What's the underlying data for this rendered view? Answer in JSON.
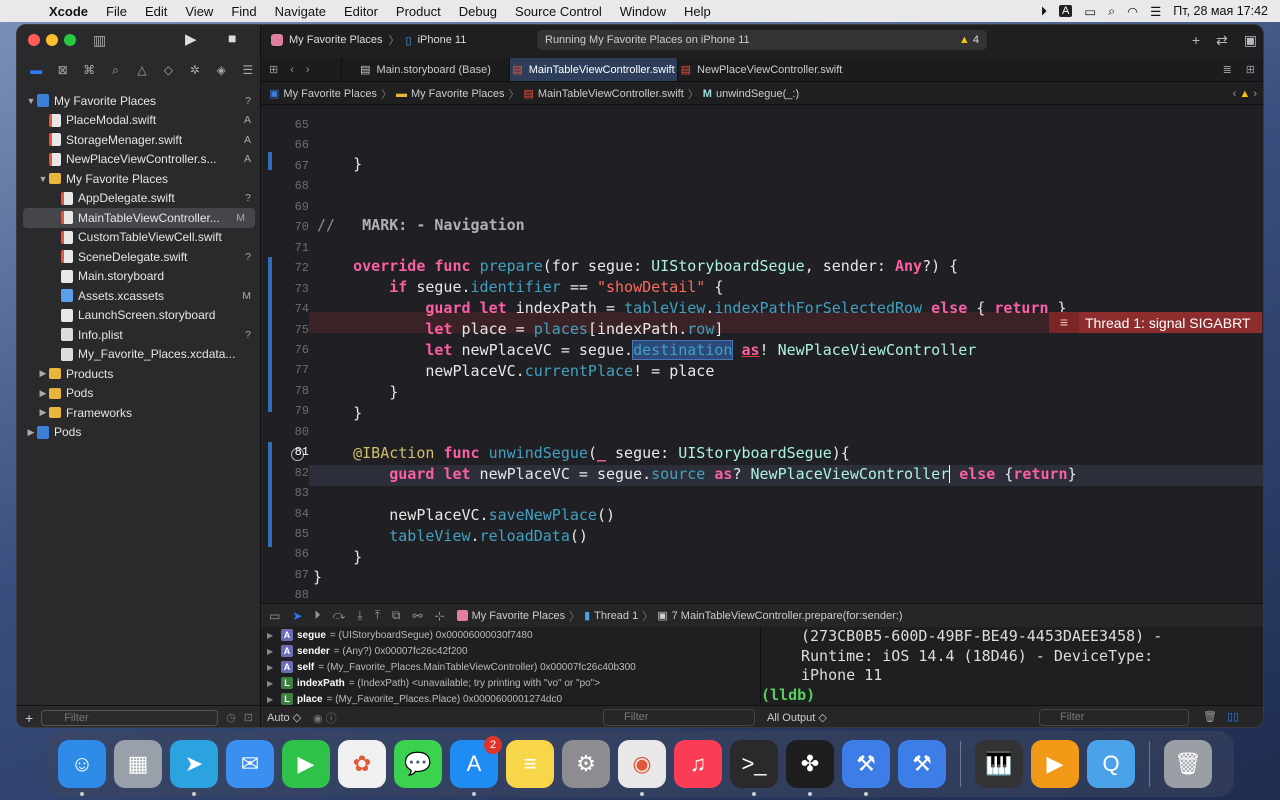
{
  "menubar": {
    "app": "Xcode",
    "items": [
      "File",
      "Edit",
      "View",
      "Find",
      "Navigate",
      "Editor",
      "Product",
      "Debug",
      "Source Control",
      "Window",
      "Help"
    ],
    "datetime": "Пт, 28 мая  17:42",
    "input_source": "A"
  },
  "toolbar": {
    "scheme": "My Favorite Places",
    "device": "iPhone 11",
    "status": "Running My Favorite Places on iPhone 11",
    "warnings": "4"
  },
  "navigator": {
    "items": [
      {
        "label": "My Favorite Places",
        "badge": "?",
        "icon": "project",
        "level": 0,
        "disclosure": "open"
      },
      {
        "label": "PlaceModal.swift",
        "badge": "A",
        "icon": "swift",
        "level": 1
      },
      {
        "label": "StorageMenager.swift",
        "badge": "A",
        "icon": "swift",
        "level": 1
      },
      {
        "label": "NewPlaceViewController.s...",
        "badge": "A",
        "icon": "swift",
        "level": 1
      },
      {
        "label": "My Favorite Places",
        "badge": "",
        "icon": "folder",
        "level": 1,
        "disclosure": "open"
      },
      {
        "label": "AppDelegate.swift",
        "badge": "?",
        "icon": "swift",
        "level": 2
      },
      {
        "label": "MainTableViewController...",
        "badge": "M",
        "icon": "swift",
        "level": 2,
        "selected": true
      },
      {
        "label": "CustomTableViewCell.swift",
        "badge": "",
        "icon": "swift",
        "level": 2
      },
      {
        "label": "SceneDelegate.swift",
        "badge": "?",
        "icon": "swift",
        "level": 2
      },
      {
        "label": "Main.storyboard",
        "badge": "",
        "icon": "storyboard",
        "level": 2
      },
      {
        "label": "Assets.xcassets",
        "badge": "M",
        "icon": "assets",
        "level": 2
      },
      {
        "label": "LaunchScreen.storyboard",
        "badge": "",
        "icon": "storyboard",
        "level": 2
      },
      {
        "label": "Info.plist",
        "badge": "?",
        "icon": "plist",
        "level": 2
      },
      {
        "label": "My_Favorite_Places.xcdata...",
        "badge": "",
        "icon": "plist",
        "level": 2
      },
      {
        "label": "Products",
        "badge": "",
        "icon": "folder",
        "level": 1,
        "disclosure": "closed"
      },
      {
        "label": "Pods",
        "badge": "",
        "icon": "folder",
        "level": 1,
        "disclosure": "closed"
      },
      {
        "label": "Frameworks",
        "badge": "",
        "icon": "folder",
        "level": 1,
        "disclosure": "closed"
      },
      {
        "label": "Pods",
        "badge": "",
        "icon": "project",
        "level": 0,
        "disclosure": "closed"
      }
    ],
    "filter_placeholder": "Filter"
  },
  "tabs": [
    {
      "label": "Main.storyboard (Base)",
      "active": false
    },
    {
      "label": "MainTableViewController.swift",
      "active": true
    },
    {
      "label": "NewPlaceViewController.swift",
      "active": false
    }
  ],
  "jumpbar": [
    "My Favorite Places",
    "My Favorite Places",
    "MainTableViewController.swift",
    "unwindSegue(_:)"
  ],
  "editor": {
    "line_numbers": [
      "65",
      "66",
      "67",
      "68",
      "69",
      "70",
      "71",
      "72",
      "73",
      "74",
      "75",
      "76",
      "77",
      "78",
      "79",
      "80",
      "81",
      "82",
      "83",
      "84",
      "85",
      "86",
      "87",
      "88"
    ],
    "error_line": "75",
    "current_line": "81",
    "error_message": "Thread 1: signal SIGABRT"
  },
  "debugbar": {
    "path": [
      "My Favorite Places",
      "Thread 1",
      "7 MainTableViewController.prepare(for:sender:)"
    ]
  },
  "variables": [
    {
      "badge": "A",
      "name": "segue",
      "value": "= (UIStoryboardSegue) 0x00006000030f7480"
    },
    {
      "badge": "A",
      "name": "sender",
      "value": "= (Any?) 0x00007fc26c42f200"
    },
    {
      "badge": "A",
      "name": "self",
      "value": "= (My_Favorite_Places.MainTableViewController) 0x00007fc26c40b300"
    },
    {
      "badge": "L",
      "name": "indexPath",
      "value": "= (IndexPath) <unavailable; try printing with \"vo\" or \"po\">"
    },
    {
      "badge": "L",
      "name": "place",
      "value": "= (My_Favorite_Places.Place) 0x0000600001274dc0"
    }
  ],
  "console": {
    "lines": [
      "(273CB0B5-600D-49BF-BE49-4453DAEE3458) -",
      "Runtime: iOS 14.4 (18D46) - DeviceType:",
      "iPhone 11"
    ],
    "prompt": "(lldb)"
  },
  "bottombar": {
    "auto": "Auto ◇",
    "filter_placeholder": "Filter",
    "all_output": "All Output ◇"
  },
  "dock": {
    "apps": [
      {
        "name": "finder-icon",
        "color": "#2f8be8",
        "glyph": "☺",
        "running": true
      },
      {
        "name": "launchpad-icon",
        "color": "#9aa0aa",
        "glyph": "▦",
        "running": false
      },
      {
        "name": "telegram-icon",
        "color": "#2aa3e0",
        "glyph": "➤",
        "running": true
      },
      {
        "name": "mail-icon",
        "color": "#3b8ff0",
        "glyph": "✉",
        "running": false
      },
      {
        "name": "facetime-icon",
        "color": "#2fc24a",
        "glyph": "▶",
        "running": false
      },
      {
        "name": "photos-icon",
        "color": "#f0f0f0",
        "glyph": "✿",
        "running": false
      },
      {
        "name": "messages-icon",
        "color": "#3ad24e",
        "glyph": "💬",
        "running": false
      },
      {
        "name": "appstore-icon",
        "color": "#1f8cf3",
        "glyph": "A",
        "running": true,
        "badge": "2"
      },
      {
        "name": "notes-icon",
        "color": "#f7d64a",
        "glyph": "≡",
        "running": false
      },
      {
        "name": "settings-icon",
        "color": "#8c8c91",
        "glyph": "⚙",
        "running": false
      },
      {
        "name": "chrome-icon",
        "color": "#e8e8e8",
        "glyph": "◉",
        "running": true
      },
      {
        "name": "music-icon",
        "color": "#fa3c55",
        "glyph": "♫",
        "running": false
      },
      {
        "name": "terminal-icon",
        "color": "#2a2a2a",
        "glyph": ">_",
        "running": true
      },
      {
        "name": "figma-icon",
        "color": "#1e1e1e",
        "glyph": "✤",
        "running": true
      },
      {
        "name": "xcode-icon",
        "color": "#3c7de8",
        "glyph": "⚒",
        "running": true
      },
      {
        "name": "xcode-beta-icon",
        "color": "#3c7de8",
        "glyph": "⚒",
        "running": false
      },
      {
        "name": "piano-icon",
        "color": "#333",
        "glyph": "🎹",
        "running": false
      },
      {
        "name": "infuse-icon",
        "color": "#f29a18",
        "glyph": "▶",
        "running": false
      },
      {
        "name": "quicktime-icon",
        "color": "#4aa3e8",
        "glyph": "Q",
        "running": false
      },
      {
        "name": "trash-icon",
        "color": "#9a9ea5",
        "glyph": "🗑",
        "running": false
      }
    ]
  }
}
